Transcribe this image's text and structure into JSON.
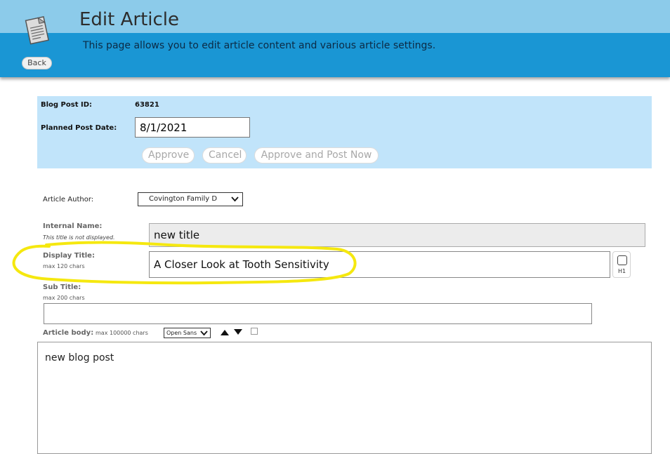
{
  "header": {
    "title": "Edit Article",
    "description": "This page allows you to edit article content and various article settings.",
    "back_label": "Back",
    "icon": "document-icon",
    "colors": {
      "banner_top": "#8ccbea",
      "banner_bottom": "#1a96d4",
      "panel": "#c1e4fa"
    }
  },
  "post_info": {
    "id_label": "Blog Post ID:",
    "id_value": "63821",
    "date_label": "Planned Post Date:",
    "date_value": "8/1/2021",
    "approve_label": "Approve",
    "cancel_label": "Cancel",
    "approve_post_label": "Approve and Post Now"
  },
  "form": {
    "author_label": "Article Author:",
    "author_value": "Covington Family D",
    "internal_name_label": "Internal Name:",
    "internal_name_hint": "This title is not displayed.",
    "internal_name_value": "new title",
    "display_title_label": "Display Title:",
    "display_title_hint": "max 120 chars",
    "display_title_value": "A Closer Look at Tooth Sensitivity",
    "h1_label": "H1",
    "sub_title_label": "Sub Title:",
    "sub_title_hint": "max 200 chars",
    "sub_title_value": "",
    "body_label": "Article body:",
    "body_hint": "max 100000 chars",
    "font_value": "Open Sans",
    "body_value": "new blog post",
    "highlight_color": "#f5e80f"
  }
}
